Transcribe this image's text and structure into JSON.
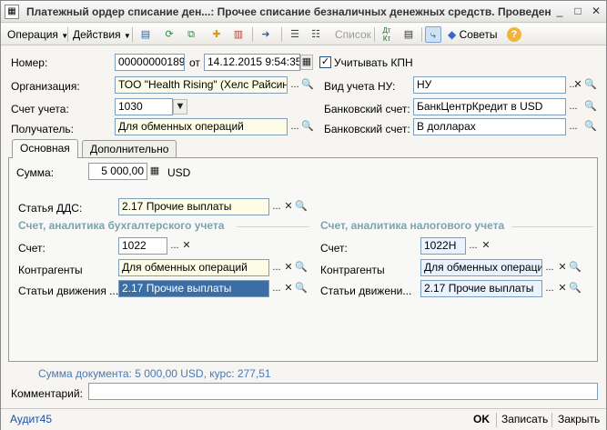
{
  "window": {
    "title": "Платежный ордер списание ден...: Прочее списание безналичных денежных средств. Проведен",
    "min_icon": "_",
    "max_icon": "□",
    "close_icon": "✕"
  },
  "toolbar": {
    "operation_label": "Операция",
    "actions_label": "Действия",
    "list_label": "Список",
    "advice_label": "Советы",
    "help_icon_text": "?",
    "dt_kt_label": "Дт Кт"
  },
  "header": {
    "number_label": "Номер:",
    "number_value": "00000000189",
    "from_label": "от",
    "date_value": "14.12.2015  9:54:35",
    "kpn_checkbox_label": "Учитывать КПН",
    "kpn_checked": true,
    "organization_label": "Организация:",
    "organization_value": "ТОО \"Health Rising\" (Хелс Райсинг)",
    "tax_accounting_label": "Вид учета НУ:",
    "tax_accounting_value": "НУ",
    "account_label": "Счет учета:",
    "account_value": "1030",
    "bank_account_label": "Банковский счет:",
    "bank_account_value": "БанкЦентрКредит в USD",
    "recipient_label": "Получатель:",
    "recipient_value": "Для обменных операций",
    "bank_account2_label": "Банковский счет:",
    "bank_account2_value": "В долларах"
  },
  "tabs": {
    "main_label": "Основная",
    "extra_label": "Дополнительно"
  },
  "main": {
    "sum_label": "Сумма:",
    "sum_value": "5 000,00",
    "currency": "USD",
    "dds_label": "Статья ДДС:",
    "dds_value": "2.17 Прочие выплаты",
    "accounting_section_title": "Счет, аналитика бухгалтерского учета",
    "tax_section_title": "Счет, аналитика налогового учета",
    "acc": {
      "account_label": "Счет:",
      "account_value": "1022",
      "counterparties_label": "Контрагенты",
      "counterparties_value": "Для обменных операций",
      "movement_label": "Статьи движения ...",
      "movement_value": "2.17 Прочие выплаты"
    },
    "tax": {
      "account_label": "Счет:",
      "account_value": "1022Н",
      "counterparties_label": "Контрагенты",
      "counterparties_value": "Для обменных операций",
      "movement_label": "Статьи движени...",
      "movement_value": "2.17 Прочие выплаты"
    }
  },
  "summary": "Сумма документа: 5 000,00 USD, курс: 277,51",
  "comment_label": "Комментарий:",
  "comment_value": "",
  "footer": {
    "user_link": "Аудит45",
    "ok_label": "OK",
    "save_label": "Записать",
    "close_label": "Закрыть"
  },
  "icons": {
    "ellipsis": "...",
    "clear": "✕",
    "search": "🔍",
    "dropdown": "▼"
  }
}
